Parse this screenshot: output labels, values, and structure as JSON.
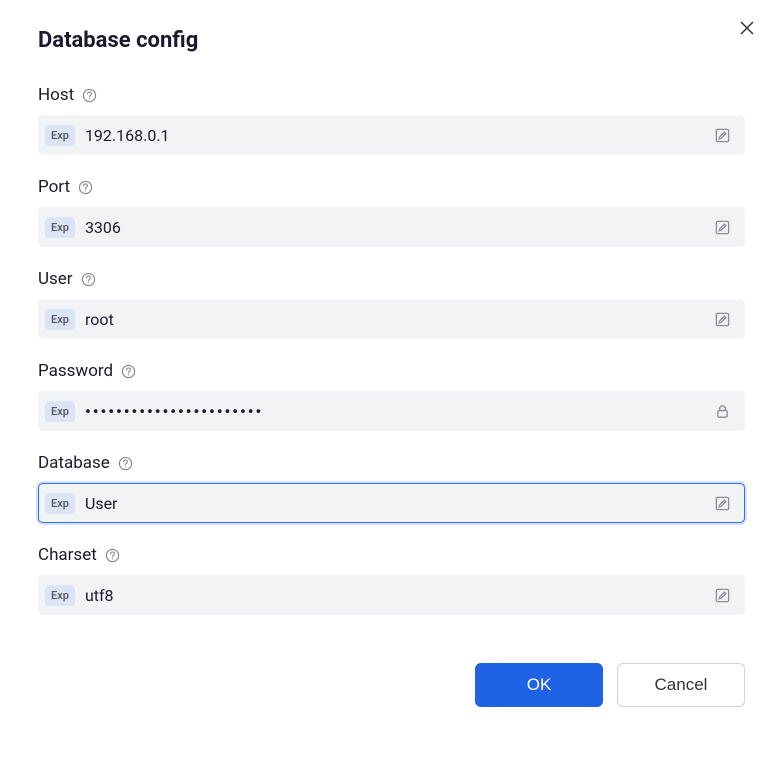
{
  "dialog": {
    "title": "Database config",
    "exp_tag": "Exp",
    "fields": {
      "host": {
        "label": "Host",
        "value": "192.168.0.1"
      },
      "port": {
        "label": "Port",
        "value": "3306"
      },
      "user": {
        "label": "User",
        "value": "root"
      },
      "password": {
        "label": "Password",
        "value": "•••••••••••••••••••••••"
      },
      "database": {
        "label": "Database",
        "value": "User"
      },
      "charset": {
        "label": "Charset",
        "value": "utf8"
      }
    },
    "buttons": {
      "ok": "OK",
      "cancel": "Cancel"
    }
  }
}
